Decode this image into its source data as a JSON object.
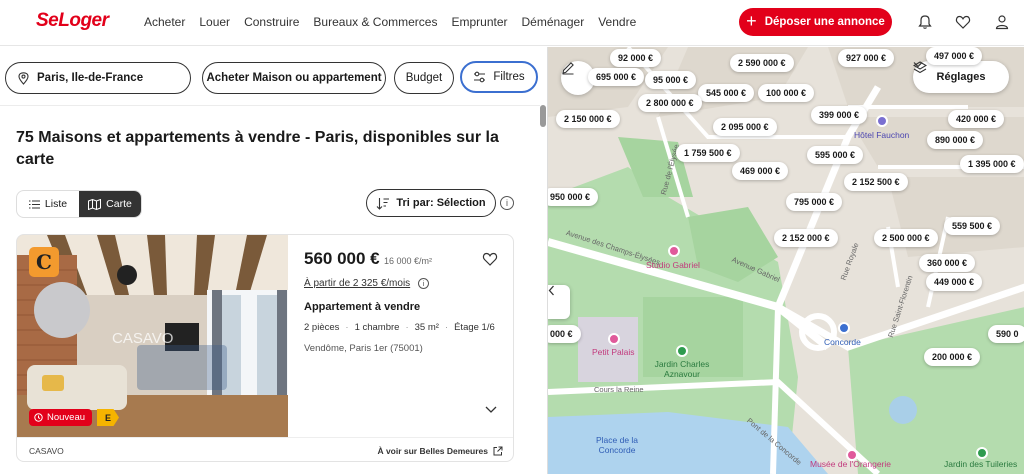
{
  "header": {
    "logo": "SeLoger",
    "nav": [
      "Acheter",
      "Louer",
      "Construire",
      "Bureaux & Commerces",
      "Emprunter",
      "Déménager",
      "Vendre"
    ],
    "post_button": "Déposer une annonce",
    "icons": [
      "bell-icon",
      "heart-icon",
      "user-icon"
    ]
  },
  "search": {
    "location": "Paris, Ile-de-France",
    "project": "Acheter Maison ou appartement",
    "budget": "Budget",
    "filters": "Filtres"
  },
  "results": {
    "title": "75 Maisons et appartements à vendre - Paris, disponibles sur la carte",
    "view_list": "Liste",
    "view_map": "Carte",
    "sort": "Tri par: Sélection"
  },
  "listing": {
    "agency_logo": "C",
    "photo_watermark": "CASAVO",
    "badge_new": "Nouveau",
    "energy_class": "E",
    "price": "560 000 €",
    "price_per_m2": "16 000 €/m²",
    "monthly": "À partir de 2 325 €/mois",
    "type": "Appartement à vendre",
    "details": [
      "2 pièces",
      "1 chambre",
      "35 m²",
      "Étage 1/6"
    ],
    "location": "Vendôme, Paris 1er (75001)",
    "agency": "CASAVO",
    "external_link": "À voir sur Belles Demeures"
  },
  "map": {
    "settings_label": "Réglages",
    "price_tags": [
      "92 000 €",
      "497 000 €",
      "695 000 €",
      "95 000 €",
      "2 590 000 €",
      "927 000 €",
      "545 000 €",
      "100 000 €",
      "2 800 000 €",
      "2 150 000 €",
      "399 000 €",
      "420 000 €",
      "2 095 000 €",
      "890 000 €",
      "1 759 500 €",
      "595 000 €",
      "1 395 000 €",
      "469 000 €",
      "2 152 500 €",
      "950 000 €",
      "795 000 €",
      "559 500 €",
      "2 152 000 €",
      "2 500 000 €",
      "360 000 €",
      "449 000 €",
      "000 €",
      "590 0",
      "200 000 €"
    ],
    "pois": [
      "Hôtel Fauchon",
      "Studio Gabriel",
      "Petit Palais",
      "Jardin Charles Aznavour",
      "Concorde",
      "Place de la Concorde",
      "Musée de l'Orangerie",
      "Jardin des Tuileries"
    ],
    "streets": [
      "Avenue des Champs-Élysées",
      "Avenue Gabriel",
      "Rue Royale",
      "Rue Saint-Florentin",
      "Cours la Reine",
      "Pont de la Concorde",
      "Rue de l'Élysée"
    ]
  }
}
